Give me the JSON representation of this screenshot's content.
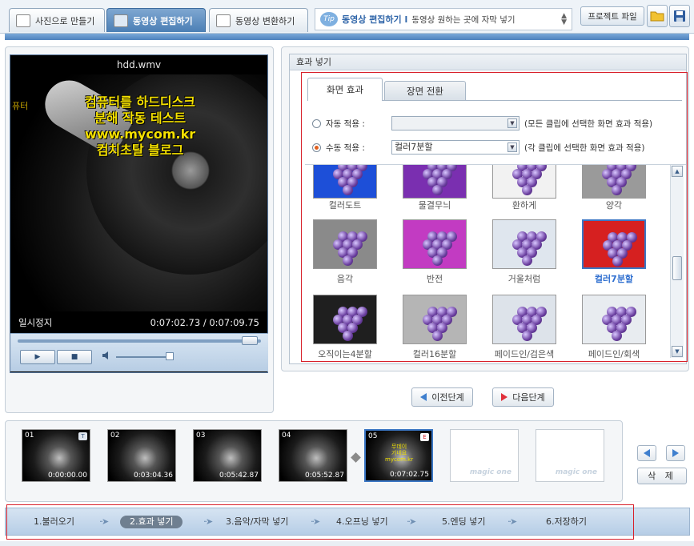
{
  "header": {
    "tabs": [
      {
        "label": "사진으로 만들기",
        "icon": "photo-icon"
      },
      {
        "label": "동영상 편집하기",
        "icon": "clapper-icon"
      },
      {
        "label": "동영상 변환하기",
        "icon": "convert-icon"
      }
    ],
    "tip": {
      "badge": "Tip",
      "title": "동영상 편집하기 l",
      "text": "동영상 원하는 곳에 자막 넣기"
    },
    "project_button": "프로젝트 파일",
    "icons": [
      "folder-open-icon",
      "save-icon"
    ]
  },
  "player": {
    "filename": "hdd.wmv",
    "overlay_lines": [
      "컴퓨터를 하드디스크",
      "분해 작동 테스트",
      "www.mycom.kr",
      "컴치초탈 블로그"
    ],
    "corner_text": "퓨터",
    "state": "일시정지",
    "time": "0:07:02.73 / 0:07:09.75",
    "seek_progress": 0.95,
    "volume": 0.9,
    "play_icon": "▶",
    "stop_icon": "■",
    "speaker_icon": "◀ॱ"
  },
  "effects": {
    "panel_title": "효과 넣기",
    "tabs": [
      "화면 효과",
      "장면 전환"
    ],
    "auto_label": "자동 적용 :",
    "auto_value": "",
    "auto_hint": "(모든 클립에 선택한 화면 효과 적용)",
    "manual_label": "수동 적용 :",
    "manual_value": "컬러7분할",
    "manual_hint": "(각 클립에 선택한 화면 효과 적용)",
    "items": [
      {
        "label": "컬러도트",
        "bg": "#1d4fd8"
      },
      {
        "label": "물결무늬",
        "bg": "#7a2fb0"
      },
      {
        "label": "환하게",
        "bg": "#f2f2f2"
      },
      {
        "label": "양각",
        "bg": "#9a9a9a"
      },
      {
        "label": "음각",
        "bg": "#8a8a8a"
      },
      {
        "label": "반전",
        "bg": "#c23bc2"
      },
      {
        "label": "거울처럼",
        "bg": "#dfe6ee"
      },
      {
        "label": "컬러7분할",
        "bg": "#d62020"
      },
      {
        "label": "오직이는4분할",
        "bg": "#1f1f1f"
      },
      {
        "label": "컬러16분할",
        "bg": "#b5b5b5"
      },
      {
        "label": "페이드인/검은색",
        "bg": "#dde3ea"
      },
      {
        "label": "페이드인/회색",
        "bg": "#e8ecf0"
      }
    ],
    "selected": "컬러7분할"
  },
  "nav": {
    "prev": "이전단계",
    "next": "다음단계"
  },
  "timeline": {
    "clips": [
      {
        "num": "01",
        "time": "0:00:00.00",
        "tag": "T"
      },
      {
        "num": "02",
        "time": "0:03:04.36",
        "tag": ""
      },
      {
        "num": "03",
        "time": "0:05:42.87",
        "tag": ""
      },
      {
        "num": "04",
        "time": "0:05:52.87",
        "tag": ""
      },
      {
        "num": "05",
        "time": "0:07:02.75",
        "tag": "E",
        "text": "무데이\n기네요\nmycom.kr"
      }
    ],
    "empty_label": "magic one",
    "delete_label": "삭 제"
  },
  "steps": [
    "1.불러오기",
    "2.효과 넣기",
    "3.음악/자막 넣기",
    "4.오프닝 넣기",
    "5.엔딩 넣기",
    "6.저장하기"
  ],
  "active_step": "2.효과 넣기"
}
